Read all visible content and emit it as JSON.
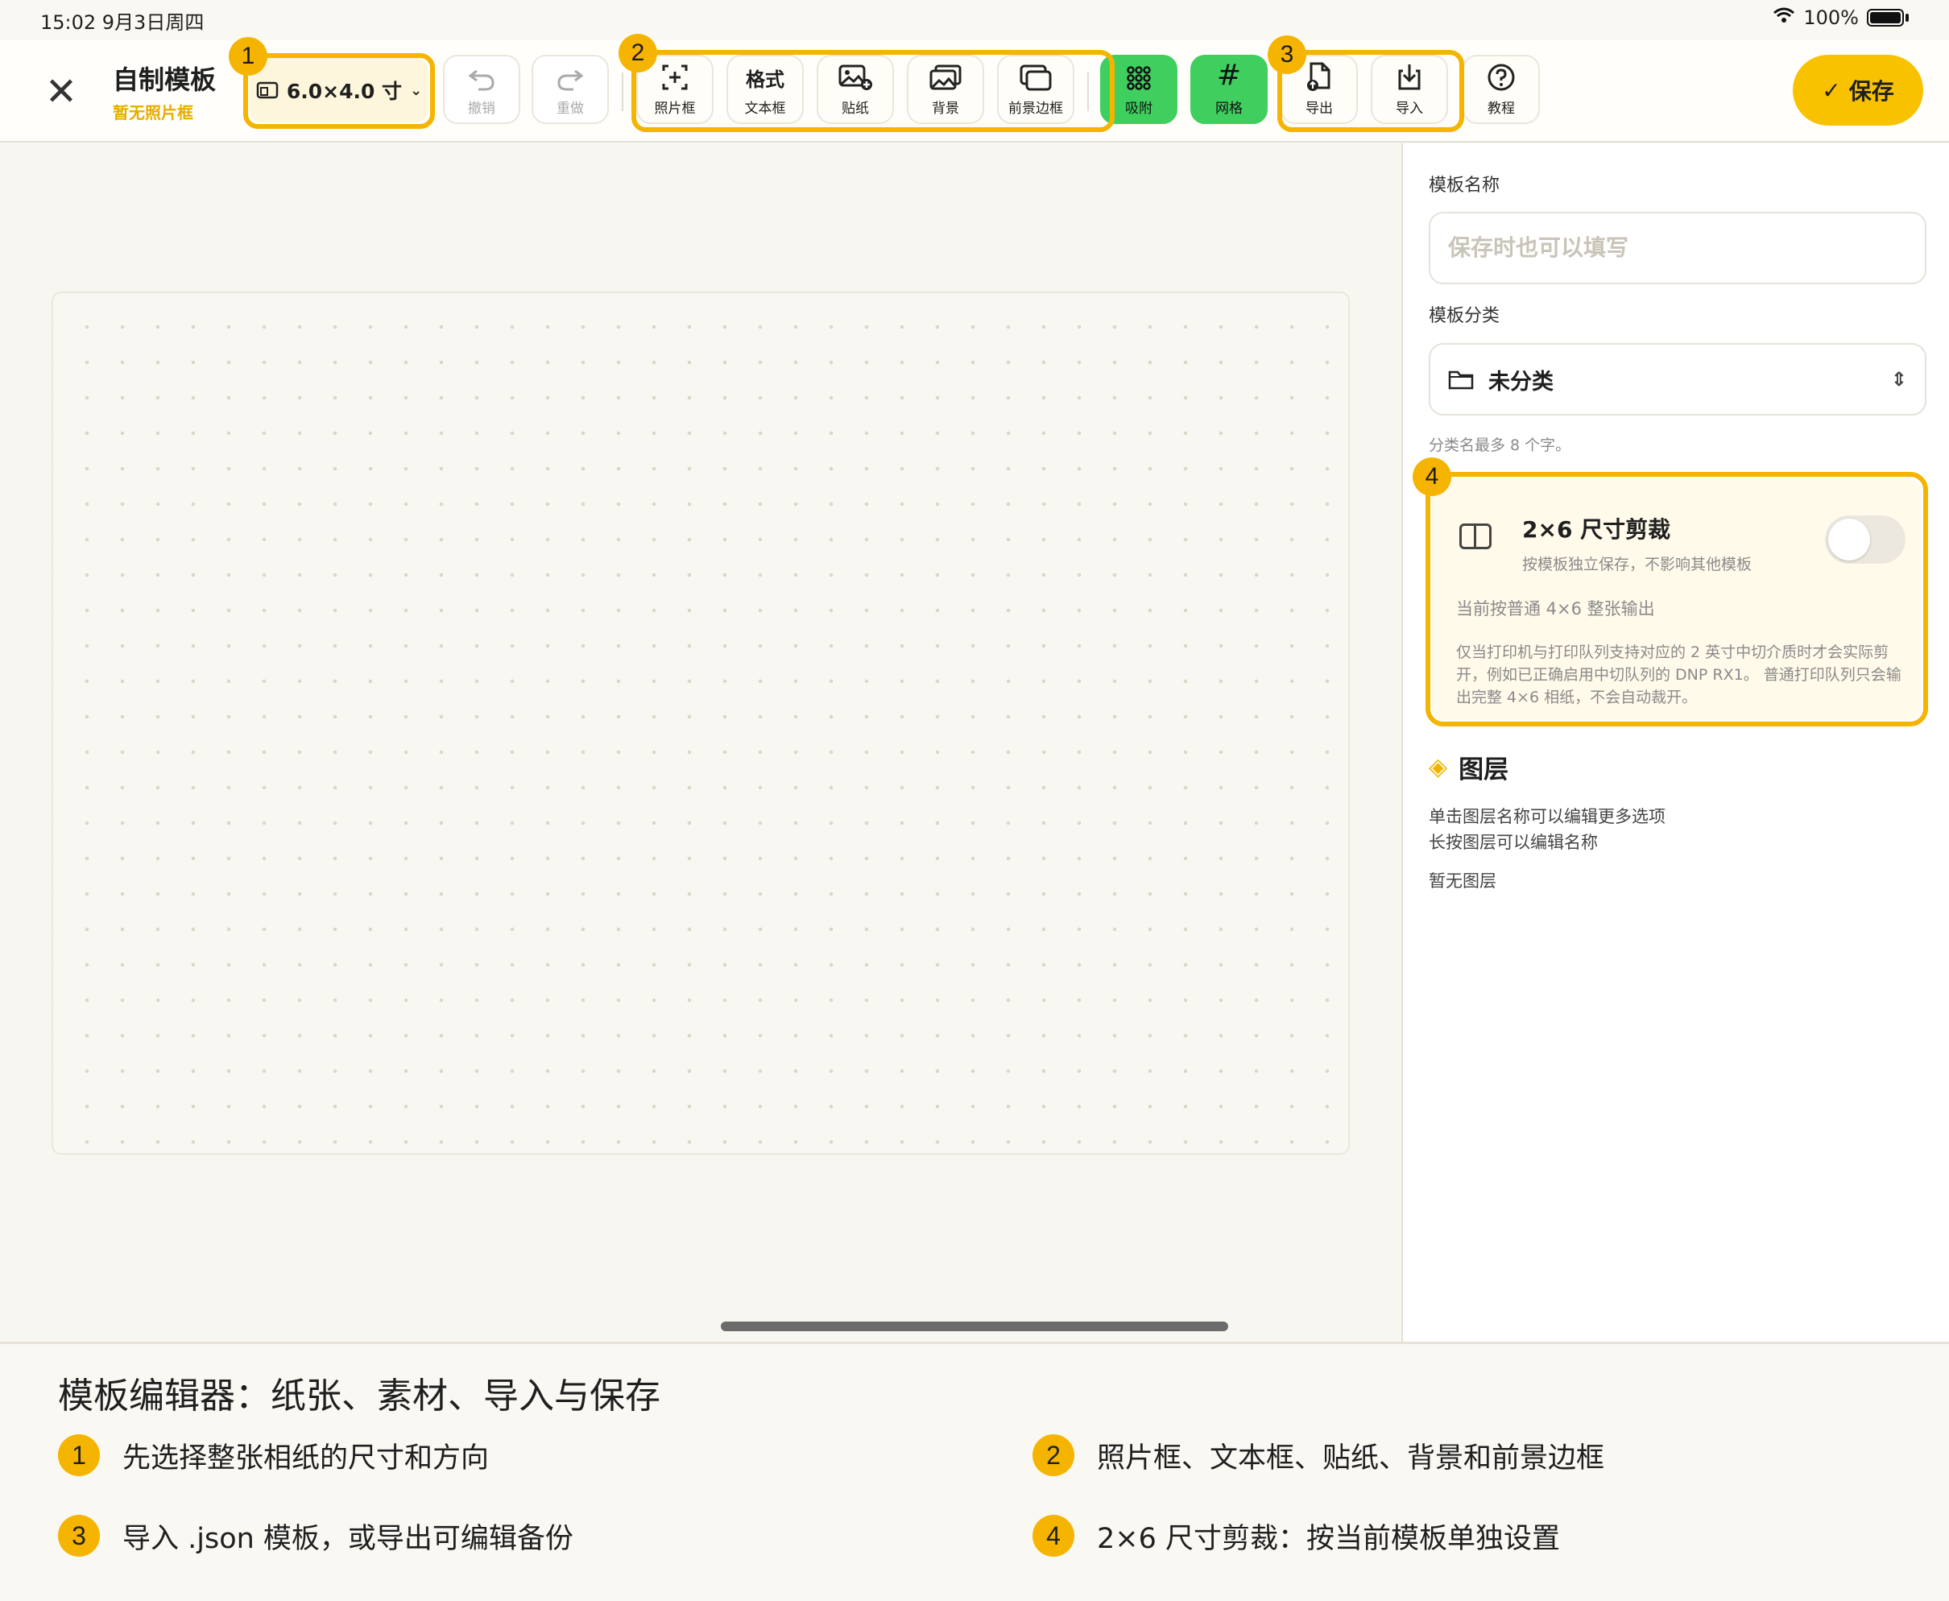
{
  "status": {
    "time": "15:02  9月3日周四",
    "battery": "100%"
  },
  "header": {
    "title": "自制模板",
    "subtitle": "暂无照片框",
    "size": "6.0×4.0 寸",
    "save": "保存"
  },
  "toolbar": {
    "undo": "撤销",
    "redo": "重做",
    "photo_frame": "照片框",
    "text_top": "格式",
    "text_frame": "文本框",
    "sticker": "贴纸",
    "background": "背景",
    "foreground": "前景边框",
    "snap": "吸附",
    "grid": "网格",
    "export": "导出",
    "import": "导入",
    "tutorial": "教程"
  },
  "panel": {
    "name_label": "模板名称",
    "name_placeholder": "保存时也可以填写",
    "category_label": "模板分类",
    "category_value": "未分类",
    "category_hint": "分类名最多 8 个字。",
    "crop_title": "2×6 尺寸剪裁",
    "crop_sub": "按模板独立保存，不影响其他模板",
    "crop_enabled": false,
    "crop_mode": "当前按普通 4×6 整张输出",
    "crop_desc": "仅当打印机与打印队列支持对应的 2 英寸中切介质时才会实际剪开，例如已正确启用中切队列的 DNP RX1。 普通打印队列只会输出完整 4×6 相纸，不会自动裁开。",
    "layers_title": "图层",
    "layers_hint1": "单击图层名称可以编辑更多选项",
    "layers_hint2": "长按图层可以编辑名称",
    "layers_empty": "暂无图层"
  },
  "badges": {
    "b1": "1",
    "b2": "2",
    "b3": "3",
    "b4": "4"
  },
  "guide": {
    "title": "模板编辑器：纸张、素材、导入与保存",
    "item1": "先选择整张相纸的尺寸和方向",
    "item2": "照片框、文本框、贴纸、背景和前景边框",
    "item3": "导入 .json 模板，或导出可编辑备份",
    "item4": "2×6 尺寸剪裁：按当前模板单独设置"
  },
  "colors": {
    "accent": "#f5b400",
    "active_tool": "#3fcf5f",
    "save": "#f9c200"
  }
}
